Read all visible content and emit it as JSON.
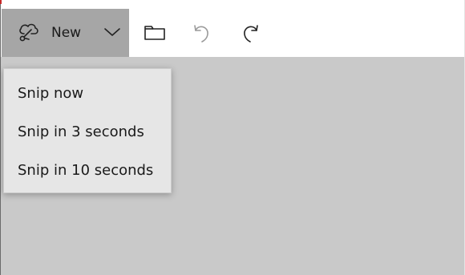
{
  "toolbar": {
    "new_label": "New",
    "new_icon": "snip-scissors-icon",
    "dropdown_icon": "chevron-down-icon",
    "open_icon": "folder-icon",
    "undo_icon": "undo-icon",
    "redo_icon": "redo-icon"
  },
  "menu": {
    "items": [
      {
        "label": "Snip now"
      },
      {
        "label": "Snip in 3 seconds"
      },
      {
        "label": "Snip in 10 seconds"
      }
    ]
  },
  "colors": {
    "toolbar_bg": "#ffffff",
    "new_group_bg": "#a6a6a6",
    "canvas_bg": "#c9c9c9",
    "menu_bg": "#e6e6e6",
    "disabled_icon": "#9a9a9a"
  }
}
